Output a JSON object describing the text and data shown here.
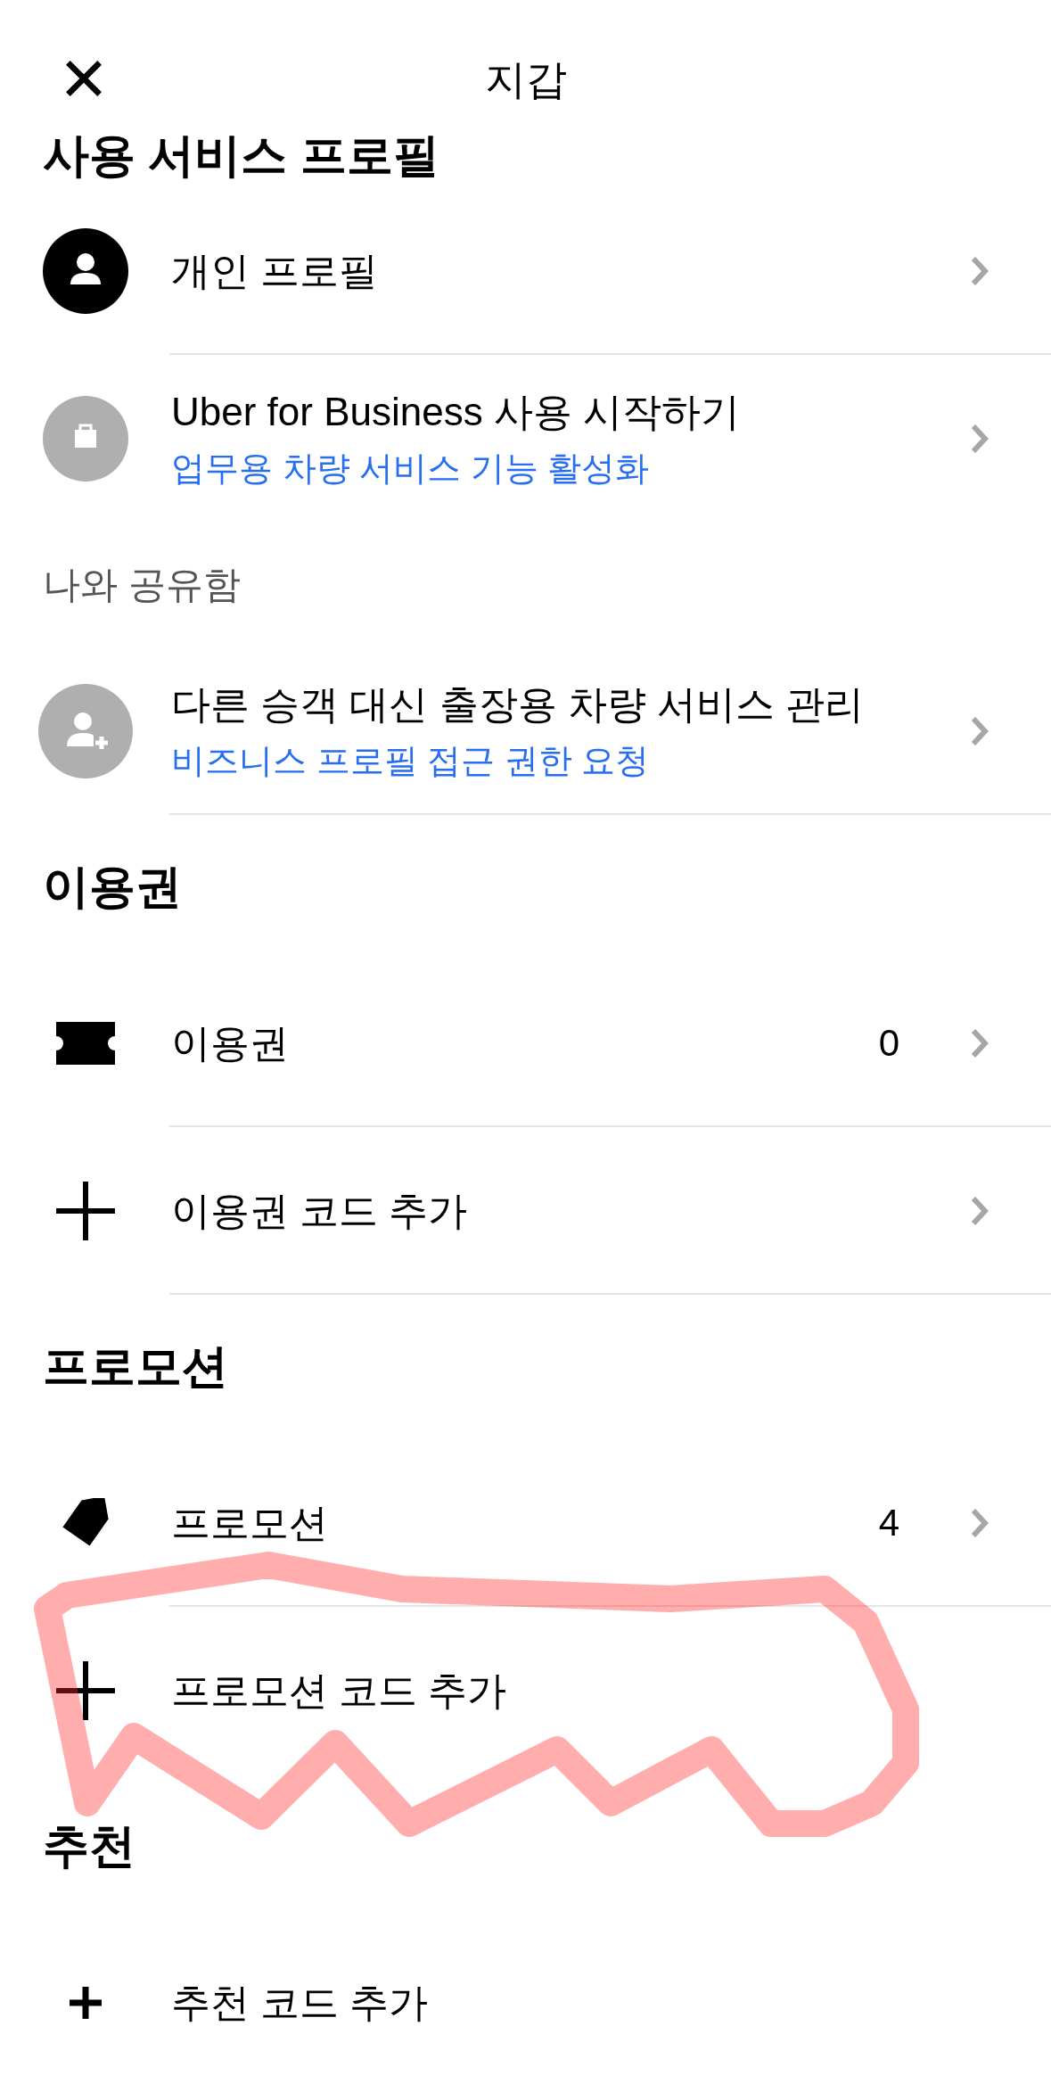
{
  "header": {
    "title": "지갑"
  },
  "sections": [
    {
      "title": "사용 서비스 프로필",
      "kind": "heading",
      "rows": [
        {
          "kind": "person",
          "title": "개인 프로필",
          "chevron": true,
          "divider": true
        },
        {
          "kind": "briefcase",
          "title": "Uber for Business 사용 시작하기",
          "subtitle": "업무용 차량 서비스 기능 활성화",
          "chevron": true,
          "divider": false
        }
      ]
    },
    {
      "title": "나와 공유함",
      "kind": "label",
      "rows": [
        {
          "kind": "person-add",
          "title": "다른 승객 대신 출장용 차량 서비스 관리",
          "subtitle": "비즈니스 프로필 접근 권한 요청",
          "chevron": true,
          "divider": true
        }
      ]
    },
    {
      "title": "이용권",
      "kind": "heading",
      "rows": [
        {
          "kind": "ticket",
          "title": "이용권",
          "count": "0",
          "chevron": true,
          "divider": true
        },
        {
          "kind": "plus",
          "title": "이용권 코드 추가",
          "chevron": true,
          "divider": true
        }
      ]
    },
    {
      "title": "프로모션",
      "kind": "heading",
      "rows": [
        {
          "kind": "tag",
          "title": "프로모션",
          "count": "4",
          "chevron": true,
          "divider": true
        },
        {
          "kind": "plus",
          "title": "프로모션 코드 추가",
          "chevron": false,
          "divider": false
        }
      ]
    },
    {
      "title": "추천",
      "kind": "heading",
      "rows": [
        {
          "kind": "plus-small",
          "title": "추천 코드 추가",
          "chevron": false,
          "divider": false
        }
      ]
    }
  ]
}
